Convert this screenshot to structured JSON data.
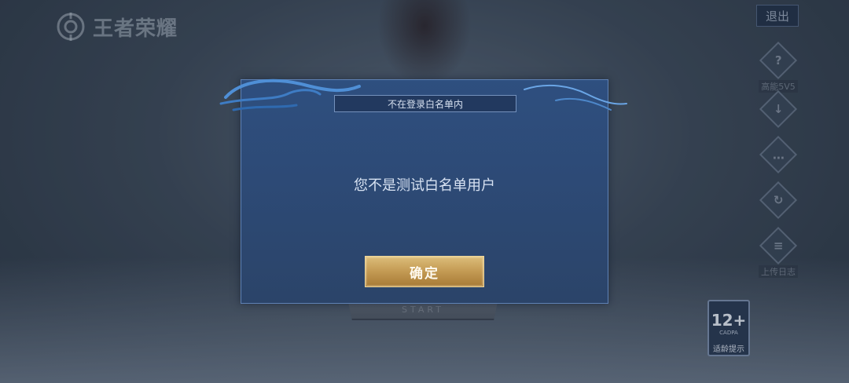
{
  "background": {
    "logo_text": "王者荣耀",
    "exit_label": "退出",
    "side_items": [
      {
        "icon": "question-icon",
        "glyph": "?",
        "label": "高能5V5"
      },
      {
        "icon": "download-icon",
        "glyph": "↓",
        "label": ""
      },
      {
        "icon": "feedback-icon",
        "glyph": "…",
        "label": ""
      },
      {
        "icon": "repair-icon",
        "glyph": "↻",
        "label": ""
      },
      {
        "icon": "log-icon",
        "glyph": "≡",
        "label": "上传日志"
      }
    ],
    "age_badge": {
      "rating": "12+",
      "org": "CADPA",
      "tip": "适龄提示"
    },
    "start_subtitle": "START"
  },
  "modal": {
    "title": "不在登录白名单内",
    "message": "您不是测试白名单用户",
    "confirm_label": "确定"
  },
  "colors": {
    "modal_bg": "#2e4f7f",
    "confirm_gold": "#c39a53",
    "title_bar": "#22395f"
  }
}
